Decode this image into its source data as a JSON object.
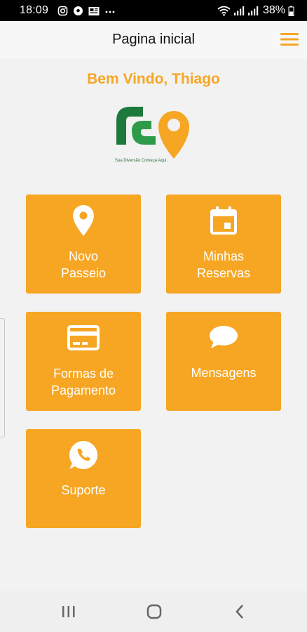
{
  "status_bar": {
    "time": "18:09",
    "battery": "38%",
    "left_icons": [
      "instagram-icon",
      "soccer-ball-icon",
      "news-icon",
      "more-dots-icon"
    ],
    "right_icons": [
      "wifi-icon",
      "signal-icon",
      "signal-icon",
      "battery-icon"
    ]
  },
  "header": {
    "title": "Pagina inicial",
    "menu_icon": "hamburger-menu-icon"
  },
  "welcome_text": "Bem Vindo, Thiago",
  "logo": {
    "tagline": "Sua Diversão Começa Aqui.",
    "colors": {
      "green": "#1d7a3c",
      "orange": "#f6a623"
    }
  },
  "tiles": [
    {
      "line1": "Novo",
      "line2": "Passeio",
      "icon": "location-pin-icon"
    },
    {
      "line1": "Minhas",
      "line2": "Reservas",
      "icon": "calendar-icon"
    },
    {
      "line1": "Formas de",
      "line2": "Pagamento",
      "icon": "credit-card-icon"
    },
    {
      "label": "Mensagens",
      "icon": "chat-bubble-icon"
    },
    {
      "label": "Suporte",
      "icon": "whatsapp-icon"
    }
  ],
  "nav_bar": {
    "icons": [
      "recent-apps-icon",
      "home-icon",
      "back-icon"
    ]
  },
  "colors": {
    "accent": "#f6a623",
    "background": "#f2f2f2"
  }
}
